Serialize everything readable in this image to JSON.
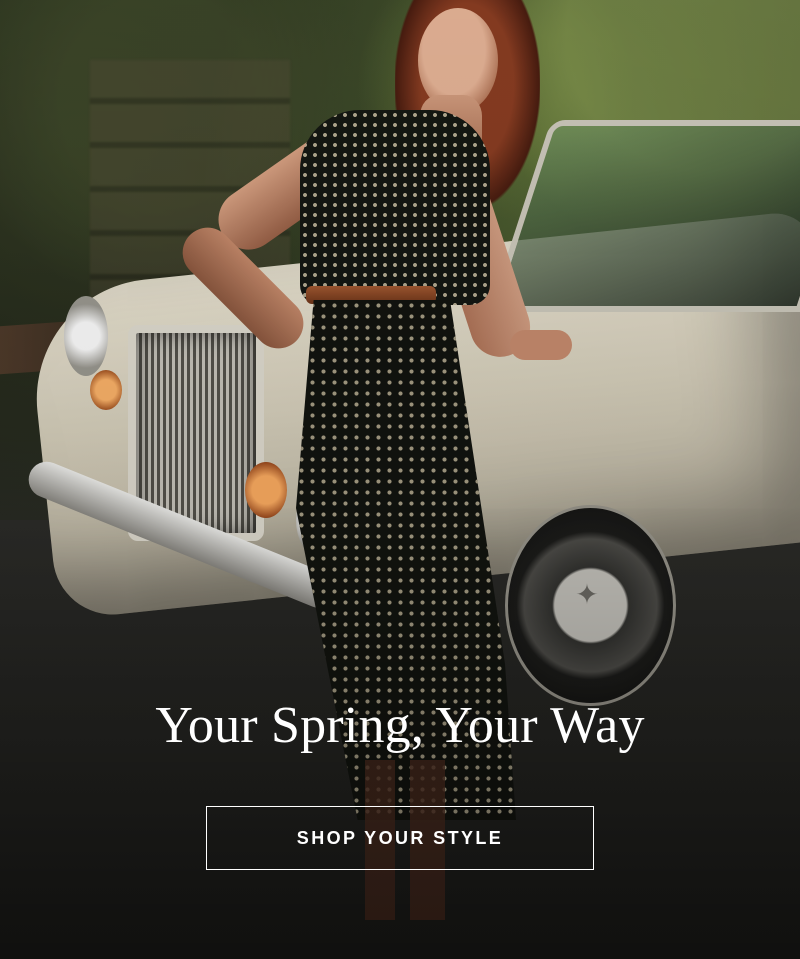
{
  "hero": {
    "headline": "Your Spring, Your Way",
    "cta_label": "SHOP YOUR STYLE",
    "image_description_icon": "photo-model-vintage-car"
  },
  "colors": {
    "text": "#ffffff",
    "button_border": "#ffffff"
  }
}
